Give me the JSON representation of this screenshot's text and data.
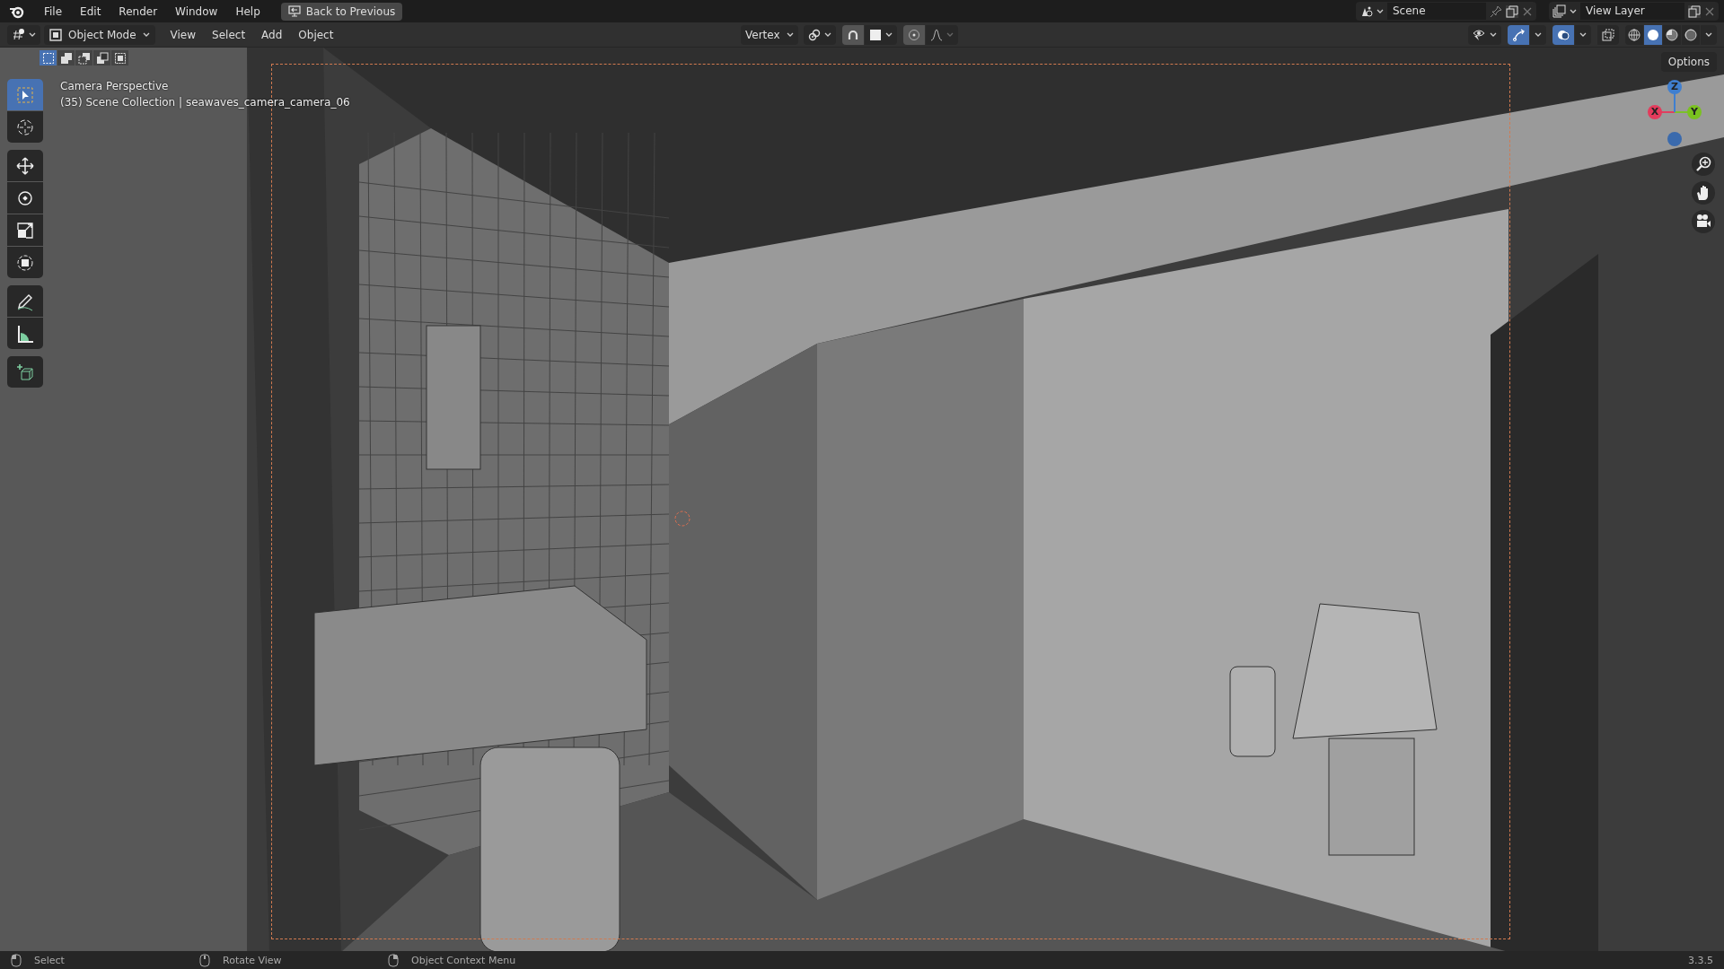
{
  "topbar": {
    "menus": [
      "File",
      "Edit",
      "Render",
      "Window",
      "Help"
    ],
    "back_button": "Back to Previous",
    "scene": "Scene",
    "view_layer": "View Layer"
  },
  "header": {
    "mode": "Object Mode",
    "menus": [
      "View",
      "Select",
      "Add",
      "Object"
    ],
    "snap_target": "Vertex",
    "toggles": [
      {
        "kind": "gizmos",
        "on": true
      },
      {
        "kind": "overlays",
        "on": true
      },
      {
        "kind": "xray",
        "on": false
      }
    ],
    "shading": [
      {
        "kind": "wireframe",
        "selected": false
      },
      {
        "kind": "solid",
        "selected": true
      },
      {
        "kind": "material",
        "selected": false
      },
      {
        "kind": "rendered",
        "selected": false
      }
    ]
  },
  "select_modes": [
    {
      "kind": "set",
      "selected": true
    },
    {
      "kind": "extend",
      "selected": false
    },
    {
      "kind": "subtract",
      "selected": false
    },
    {
      "kind": "invert",
      "selected": false
    },
    {
      "kind": "intersect",
      "selected": false
    }
  ],
  "tool_groups": [
    [
      {
        "kind": "select",
        "selected": true
      },
      {
        "kind": "cursor",
        "selected": false
      }
    ],
    [
      {
        "kind": "move",
        "selected": false
      },
      {
        "kind": "rotate",
        "selected": false
      },
      {
        "kind": "scale",
        "selected": false
      },
      {
        "kind": "transform",
        "selected": false
      }
    ],
    [
      {
        "kind": "annotate",
        "selected": false
      },
      {
        "kind": "measure",
        "selected": false
      }
    ],
    [
      {
        "kind": "add_cube",
        "selected": false
      }
    ]
  ],
  "viewport": {
    "title": "Camera Perspective",
    "info": "(35) Scene Collection | seawaves_camera_camera_06",
    "options": "Options",
    "axes": [
      {
        "kind": "z",
        "label": "Z"
      },
      {
        "kind": "x",
        "label": "X"
      },
      {
        "kind": "y",
        "label": "Y"
      }
    ]
  },
  "status_bar": {
    "items": [
      {
        "kind": "left",
        "label": "Select"
      },
      {
        "kind": "middle",
        "label": "Rotate View"
      },
      {
        "kind": "right",
        "label": "Object Context Menu"
      }
    ],
    "version": "3.3.5"
  }
}
